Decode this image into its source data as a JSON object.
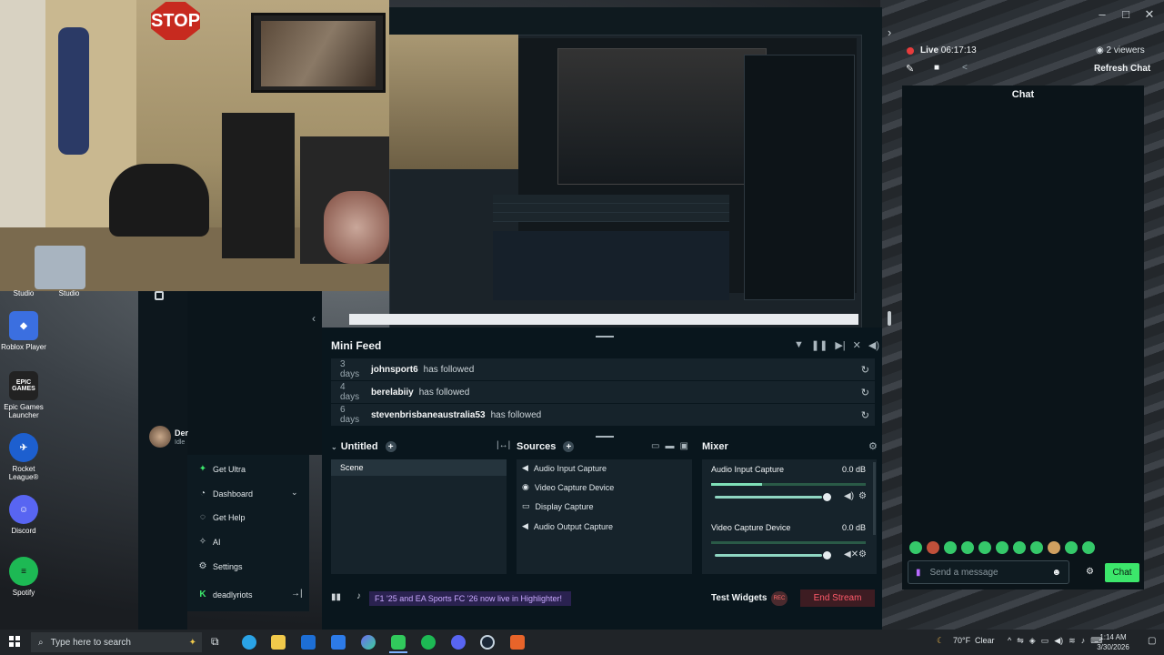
{
  "desktop": {
    "icons": [
      {
        "label": "Studio"
      },
      {
        "label": "Studio"
      },
      {
        "label": "Roblox Player"
      },
      {
        "label": "Epic Games Launcher"
      },
      {
        "label": "Rocket League®"
      },
      {
        "label": "Discord"
      },
      {
        "label": "Spotify"
      }
    ],
    "epic_logo": "EPIC GAMES"
  },
  "webcam": {
    "stop_sign": "STOP"
  },
  "window": {
    "controls": [
      "–",
      "□",
      "✕"
    ],
    "collapse_arrow": "‹",
    "expand_arrow": "›"
  },
  "mini_feed": {
    "title": "Mini Feed",
    "items": [
      {
        "ago": "3 days",
        "user": "johnsport6",
        "action": "has followed"
      },
      {
        "ago": "4 days",
        "user": "berelabiiy",
        "action": "has followed"
      },
      {
        "ago": "6 days",
        "user": "stevenbrisbaneaustralia53",
        "action": "has followed"
      }
    ]
  },
  "scenes": {
    "title": "Untitled",
    "items": [
      "Scene"
    ]
  },
  "sources": {
    "title": "Sources",
    "items": [
      {
        "label": "Audio Input Capture",
        "icon": "speaker-icon"
      },
      {
        "label": "Video Capture Device",
        "icon": "camera-icon"
      },
      {
        "label": "Display Capture",
        "icon": "monitor-icon"
      },
      {
        "label": "Audio Output Capture",
        "icon": "speaker-icon"
      }
    ]
  },
  "mixer": {
    "title": "Mixer",
    "channels": [
      {
        "name": "Audio Input Capture",
        "level": "0.0 dB",
        "volume": 0.95
      },
      {
        "name": "Video Capture Device",
        "level": "0.0 dB",
        "volume": 0.95
      }
    ]
  },
  "user": {
    "name": "Der",
    "status": "Idle"
  },
  "nav": {
    "items": [
      {
        "label": "Get Ultra",
        "icon": "ultra-icon"
      },
      {
        "label": "Dashboard",
        "icon": "dashboard-icon"
      },
      {
        "label": "Get Help",
        "icon": "help-icon"
      },
      {
        "label": "AI",
        "icon": "ai-icon"
      },
      {
        "label": "Settings",
        "icon": "gear-icon"
      },
      {
        "label": "deadlyriots",
        "icon": "streamlabs-icon"
      }
    ]
  },
  "bottom_bar": {
    "ticker": "F1 '25 and EA Sports FC '26 now live in Highlighter!",
    "test_widgets": "Test Widgets",
    "rec": "REC",
    "end_stream": "End Stream"
  },
  "live": {
    "status": "Live",
    "time": "06:17:13",
    "viewers": "2 viewers",
    "refresh": "Refresh Chat"
  },
  "chat": {
    "title": "Chat",
    "placeholder": "Send a message",
    "button": "Chat"
  },
  "taskbar": {
    "search_placeholder": "Type here to search",
    "weather": "70°F",
    "weather_desc": "Clear",
    "time": "1:14 AM",
    "date": "3/30/2026"
  },
  "colors": {
    "accent": "#3ce66b",
    "live_dot": "#e83c3c",
    "end_stream": "#ff5a6a"
  }
}
